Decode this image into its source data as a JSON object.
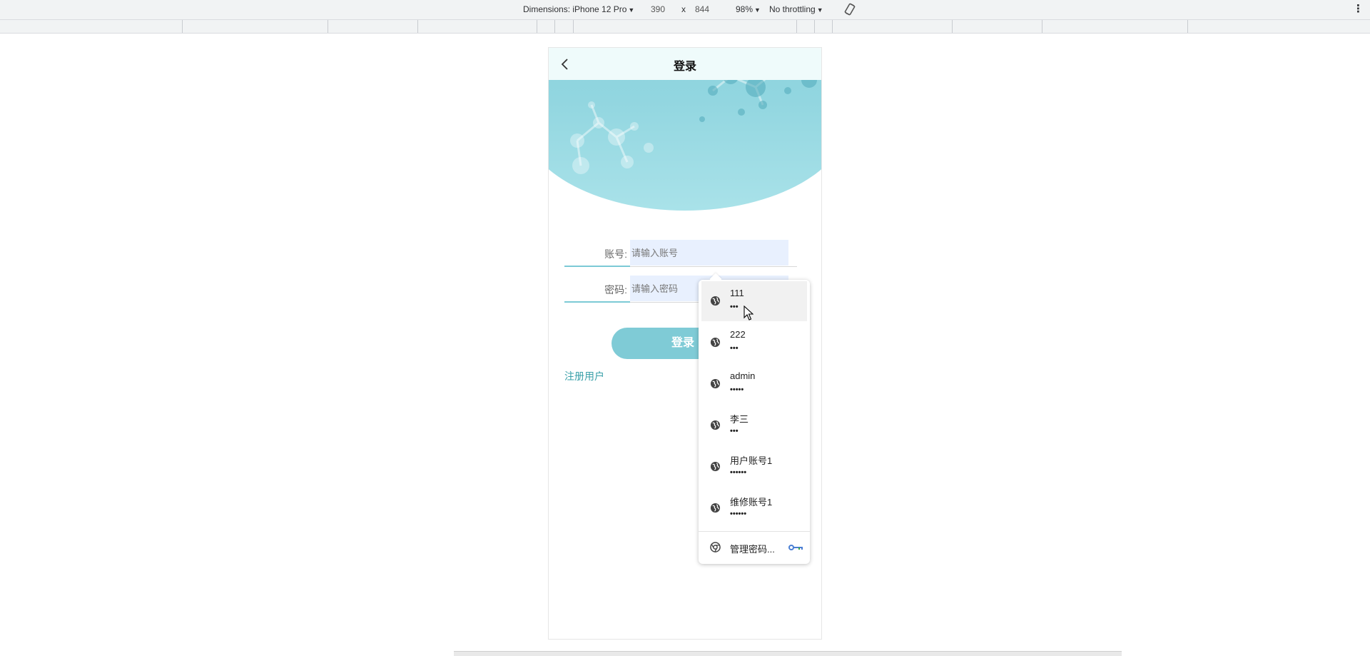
{
  "devtools": {
    "dimensions_label": "Dimensions: iPhone 12 Pro",
    "width": "390",
    "times": "x",
    "height": "844",
    "zoom": "98%",
    "throttling": "No throttling",
    "caret": "▼",
    "more": "⋮"
  },
  "page": {
    "title": "登录",
    "account_label": "账号:",
    "account_placeholder": "请输入账号",
    "password_label": "密码:",
    "password_placeholder": "请输入密码",
    "login_button": "登录",
    "register_link": "注册用户"
  },
  "autofill": {
    "entries": [
      {
        "user": "111",
        "pass": "•••"
      },
      {
        "user": "222",
        "pass": "•••"
      },
      {
        "user": "admin",
        "pass": "•••••"
      },
      {
        "user": "李三",
        "pass": "•••"
      },
      {
        "user": "用户账号1",
        "pass": "••••••"
      },
      {
        "user": "维修账号1",
        "pass": "••••••"
      }
    ],
    "manage_label": "管理密码..."
  },
  "colors": {
    "accent": "#7fcbd6",
    "link": "#3aa0a9",
    "autofill_bg": "#e8f0fe"
  }
}
